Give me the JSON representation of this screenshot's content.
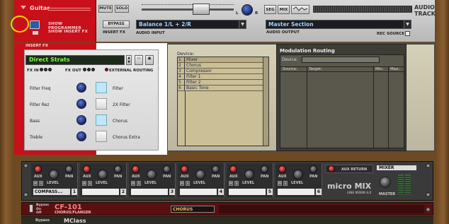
{
  "track": {
    "name": "Guitar",
    "show_programmer": "SHOW PROGRAMMER",
    "show_insert_fx": "SHOW INSERT FX",
    "audio_track_title": "AUDIO\nTRACK"
  },
  "header": {
    "mute": "MUTE",
    "solo": "SOLO",
    "bypass": "BYPASS",
    "insert_fx": "INSERT FX",
    "audio_input_value": "Balance 1/L + 2/R",
    "audio_input_label": "AUDIO INPUT",
    "pan_l": "L",
    "pan_r": "R",
    "seg": "SEG",
    "mix": "MIX",
    "audio_output_value": "Master Section",
    "audio_output_label": "AUDIO OUTPUT",
    "rec_source": "REC SOURCE"
  },
  "insert": {
    "header": "INSERT FX",
    "patch_name": "Direct Strats",
    "fx_in": "FX IN",
    "fx_out": "FX OUT",
    "external_routing": "EXTERNAL ROUTING",
    "controls": [
      {
        "knob": "Filter Freq",
        "button": "Filter",
        "on": true
      },
      {
        "knob": "Filter Rez",
        "button": "2X Filter",
        "on": false
      },
      {
        "knob": "Bass",
        "button": "Chorus",
        "on": true
      },
      {
        "knob": "Treble",
        "button": "Chorus Extra",
        "on": false
      }
    ]
  },
  "device": {
    "device_label": "Device:",
    "items": [
      {
        "n": "1",
        "name": "Mixer"
      },
      {
        "n": "2",
        "name": "Chorus"
      },
      {
        "n": "3",
        "name": "Compressor"
      },
      {
        "n": "4",
        "name": "Filter 1"
      },
      {
        "n": "5",
        "name": "Filter 2"
      },
      {
        "n": "6",
        "name": "Basic Tone"
      }
    ],
    "mod_title": "Modulation Routing",
    "mod_device_label": "Device:",
    "mod_cols": [
      "Source:",
      "Target:",
      "Min:",
      "Max:"
    ]
  },
  "mixer": {
    "channel1_name": "COMPASS...",
    "aux": "AUX",
    "pan": "PAN",
    "level": "LEVEL",
    "channels": [
      "1",
      "2",
      "3",
      "4",
      "5",
      "6"
    ],
    "aux_return": "AUX RETURN",
    "mixer_label": "MIXER",
    "brand": "micro MIX",
    "brand_sub": "LINE MIXER 6:2",
    "master": "MASTER",
    "m": "M",
    "s": "S"
  },
  "cf101": {
    "bypass": "Bypass",
    "on": "On",
    "off": "Off",
    "title": "CF-101",
    "subtitle": "CHORUS/FLANGER",
    "patch": "CHORUS"
  },
  "next_device": {
    "bypass": "Bypass",
    "name": "MClass"
  }
}
